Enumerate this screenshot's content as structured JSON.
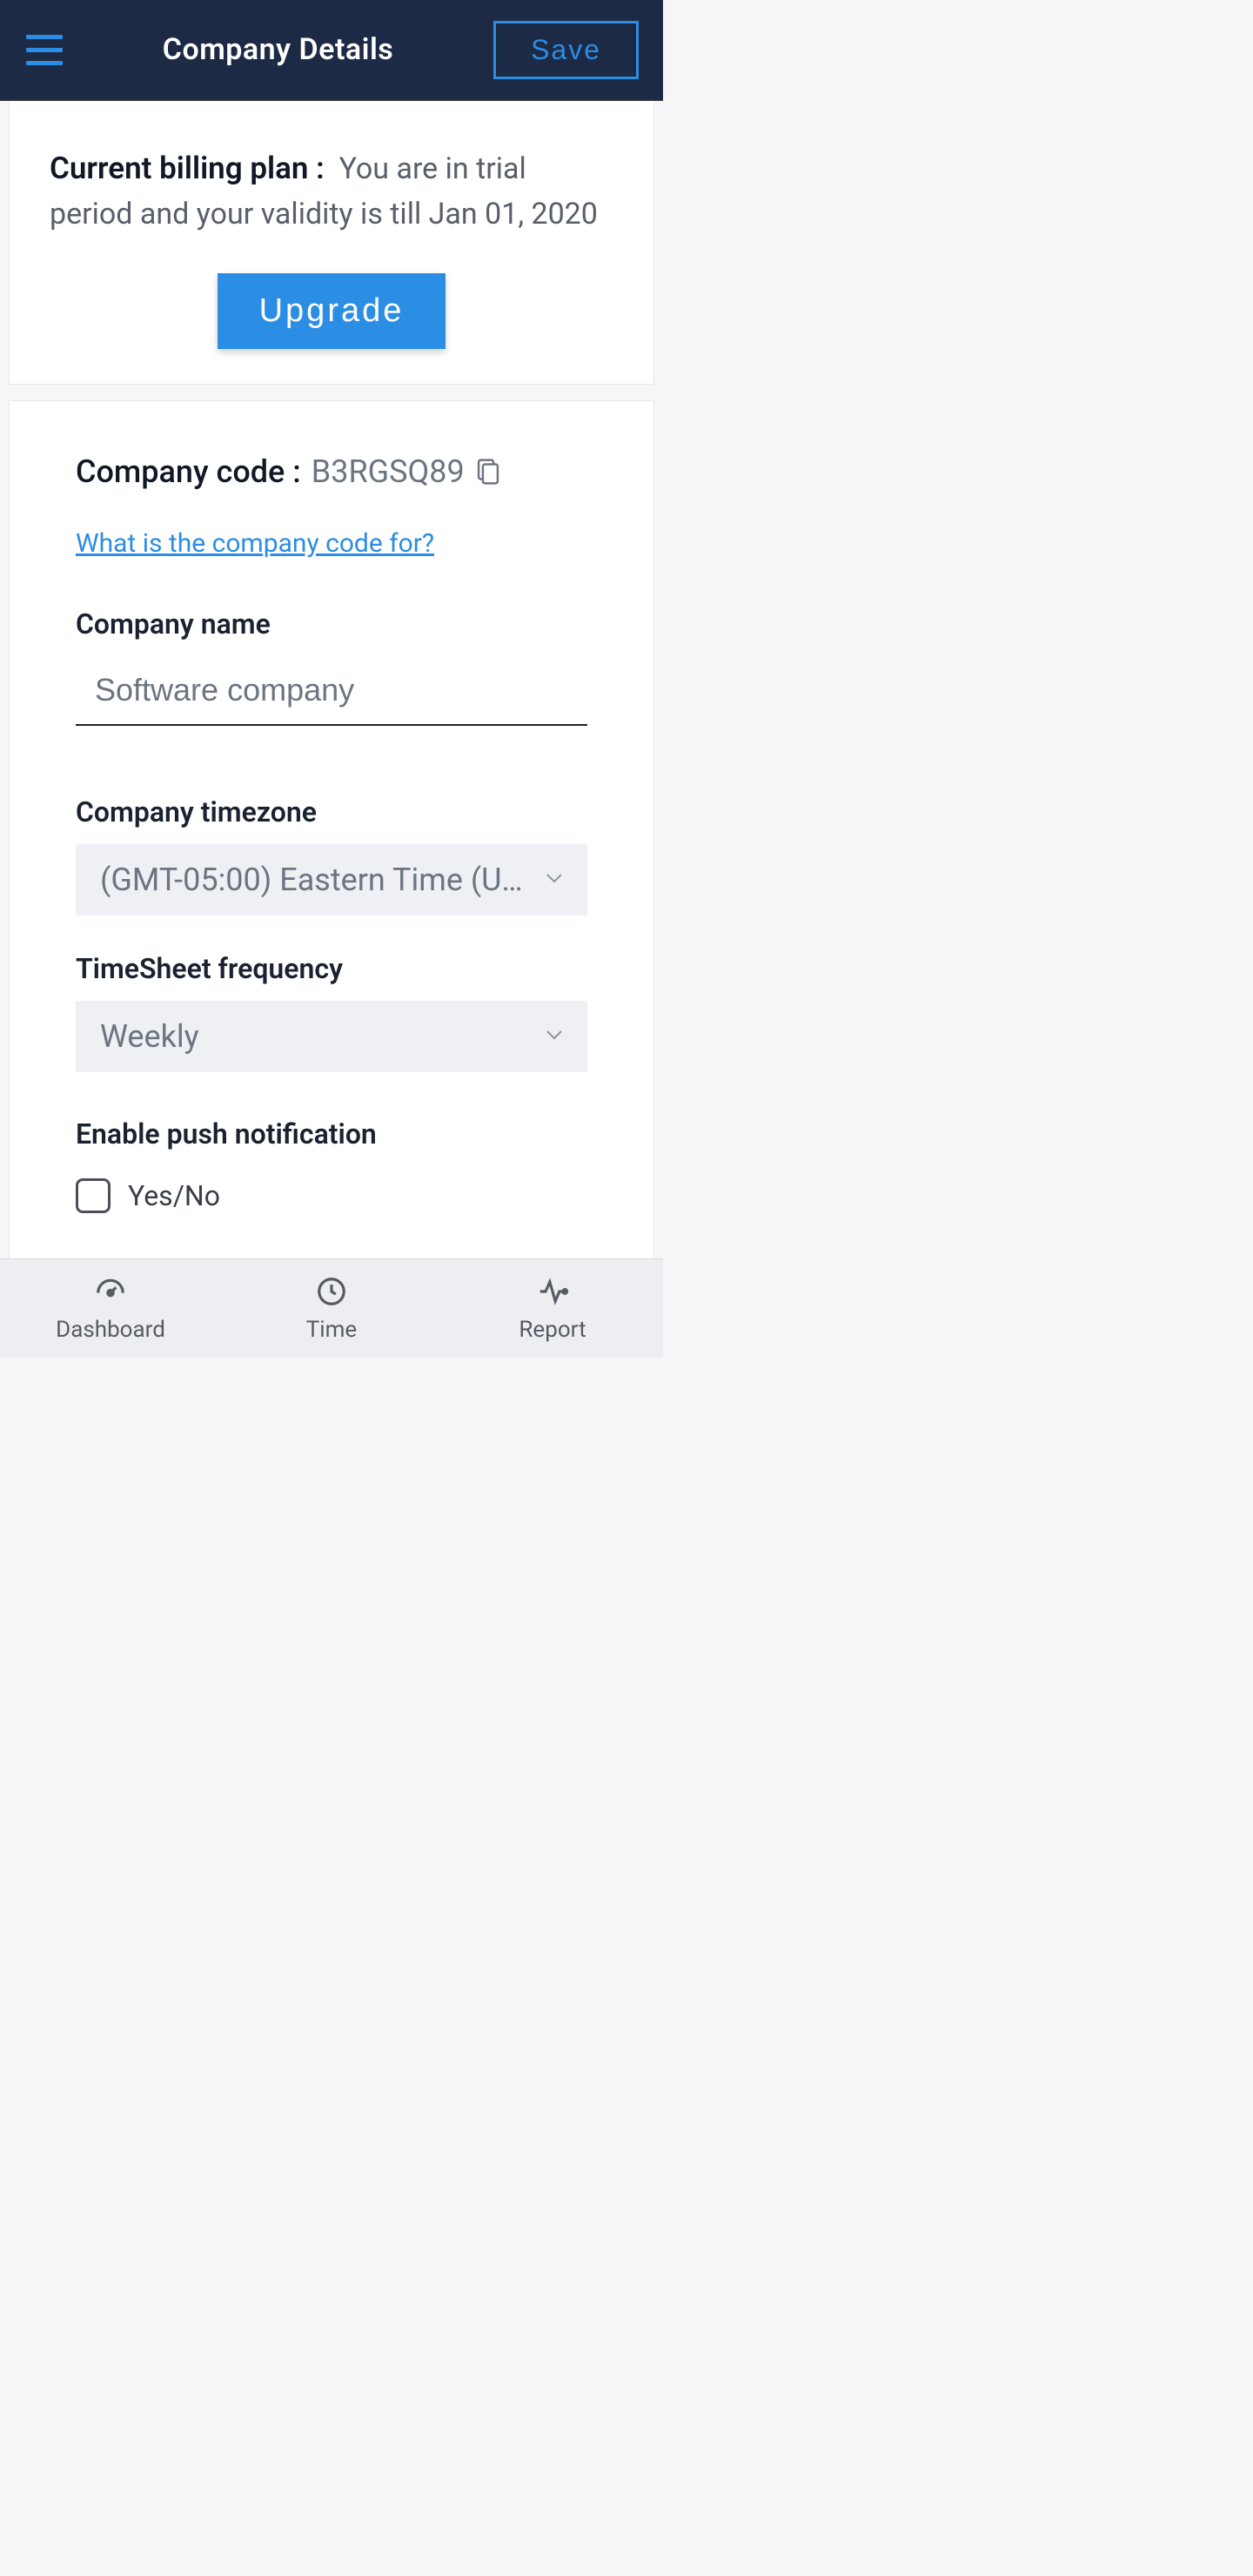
{
  "header": {
    "title": "Company Details",
    "save_label": "Save"
  },
  "billing": {
    "label": "Current billing plan :",
    "text": "You are in trial period and your validity is till Jan 01, 2020",
    "upgrade_label": "Upgrade"
  },
  "company": {
    "code_label": "Company code :",
    "code_value": "B3RGSQ89",
    "help_link": "What is the company code for?",
    "name_label": "Company name",
    "name_value": "Software company",
    "timezone_label": "Company timezone",
    "timezone_value": "(GMT-05:00) Eastern Time (U…",
    "freq_label": "TimeSheet frequency",
    "freq_value": "Weekly",
    "push_label": "Enable push notification",
    "push_option": "Yes/No"
  },
  "nav": {
    "dashboard": "Dashboard",
    "time": "Time",
    "report": "Report"
  }
}
